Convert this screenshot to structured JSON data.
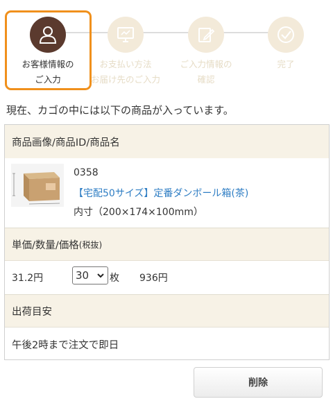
{
  "stepper": {
    "steps": [
      {
        "label": "お客様情報の\nご入力",
        "icon": "user-icon",
        "state": "active"
      },
      {
        "label": "お支払い方法\nお届け先のご入力",
        "icon": "monitor-icon",
        "state": "inactive"
      },
      {
        "label": "ご入力情報の\n確認",
        "icon": "edit-icon",
        "state": "inactive"
      },
      {
        "label": "完了",
        "icon": "check-icon",
        "state": "inactive"
      }
    ],
    "active_color": "#5b3a2e",
    "inactive_color": "#f3ead9",
    "highlight_color": "#f0901c"
  },
  "intro_text": "現在、カゴの中には以下の商品が入っています。",
  "cart": {
    "header": "商品画像/商品ID/商品名",
    "product": {
      "id": "0358",
      "name": "【宅配50サイズ】定番ダンボール箱(茶)",
      "size": "内寸（200×174×100mm）",
      "thumb_icon": "cardboard-box-icon"
    },
    "price_header": "単価/数量/価格",
    "price_header_note": "(税抜)",
    "unit_price": "31.2円",
    "quantity": "30",
    "quantity_unit": "枚",
    "total": "936円",
    "ship_header": "出荷目安",
    "ship_text": "午後2時まで注文で即日"
  },
  "delete_label": "削除",
  "link_color": "#2f7ec4"
}
